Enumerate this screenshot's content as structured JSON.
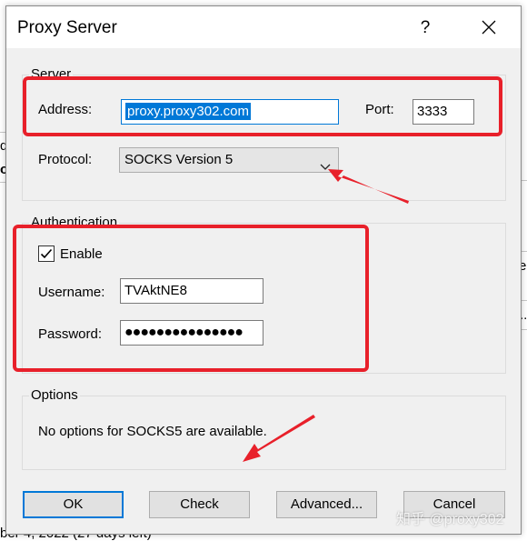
{
  "dialog": {
    "title": "Proxy Server",
    "help_label": "?",
    "close_icon": "close-icon"
  },
  "server": {
    "legend": "Server",
    "address_label": "Address:",
    "address_value": "proxy.proxy302.com",
    "port_label": "Port:",
    "port_value": "3333",
    "protocol_label": "Protocol:",
    "protocol_value": "SOCKS Version 5"
  },
  "auth": {
    "legend": "Authentication",
    "enable_label": "Enable",
    "enable_checked": true,
    "username_label": "Username:",
    "username_value": "TVAktNE8",
    "password_label": "Password:",
    "password_value": "●●●●●●●●●●●●●●●"
  },
  "options": {
    "legend": "Options",
    "message": "No options for SOCKS5 are available."
  },
  "buttons": {
    "ok": "OK",
    "check": "Check",
    "advanced": "Advanced...",
    "cancel": "Cancel"
  },
  "background": {
    "frag_left_1": "d",
    "frag_left_2": "o",
    "frag_right_1": "e",
    "frag_right_2": "..",
    "frag_bottom": "ber 4, 2022 (27 days left)"
  },
  "watermark": "知乎 @proxy302",
  "colors": {
    "highlight": "#e8202a",
    "focus": "#0078d7",
    "dialog_bg": "#f0f0f0"
  }
}
